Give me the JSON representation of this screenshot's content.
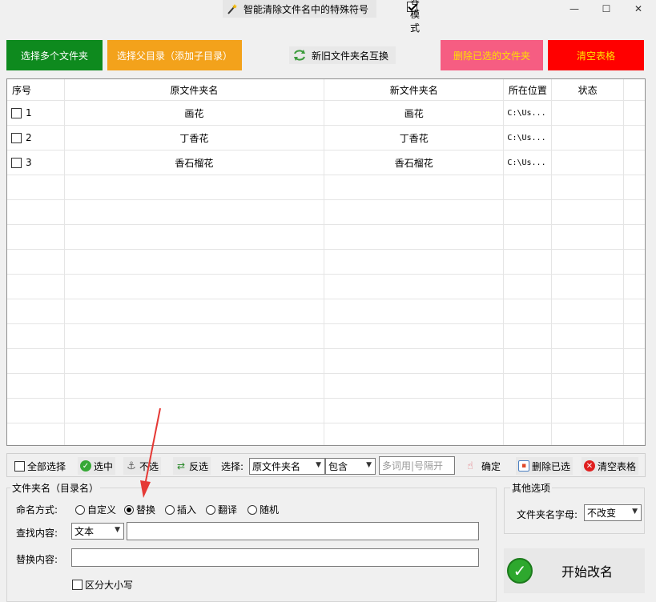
{
  "window": {
    "title": "智能清除文件名中的特殊符号",
    "compat_label": "兼容模式",
    "compat_checked": true,
    "minimize": "—",
    "maximize": "☐",
    "close": "✕"
  },
  "top_buttons": {
    "select_folders": "选择多个文件夹",
    "select_parent": "选择父目录（添加子目录）",
    "swap_names": "新旧文件夹名互换",
    "delete_selected": "删除已选的文件夹",
    "clear_table": "清空表格"
  },
  "table": {
    "columns": [
      "序号",
      "原文件夹名",
      "新文件夹名",
      "所在位置",
      "状态"
    ],
    "rows": [
      {
        "index": "1",
        "original": "画花",
        "new": "画花",
        "location": "C:\\Us...",
        "status": ""
      },
      {
        "index": "2",
        "original": "丁香花",
        "new": "丁香花",
        "location": "C:\\Us...",
        "status": ""
      },
      {
        "index": "3",
        "original": "香石榴花",
        "new": "香石榴花",
        "location": "C:\\Us...",
        "status": ""
      }
    ]
  },
  "toolbar": {
    "select_all": "全部选择",
    "check": "选中",
    "uncheck": "不选",
    "invert": "反选",
    "select_label": "选择:",
    "field_select": "原文件夹名",
    "match_select": "包含",
    "keyword_placeholder": "多词用|号隔开",
    "confirm": "确定",
    "delete_selected": "删除已选",
    "clear_table": "清空表格"
  },
  "folder_group": {
    "title": "文件夹名（目录名）",
    "naming_label": "命名方式:",
    "naming_options": [
      "自定义",
      "替换",
      "插入",
      "翻译",
      "随机"
    ],
    "naming_selected": "替换",
    "find_label": "查找内容:",
    "find_type": "文本",
    "find_value": "",
    "replace_label": "替换内容:",
    "replace_value": "",
    "case_sensitive_label": "区分大小写"
  },
  "other_group": {
    "title": "其他选项",
    "letter_label": "文件夹名字母:",
    "letter_value": "不改变"
  },
  "start_button": "开始改名",
  "colors": {
    "green": "#0e8a1e",
    "orange": "#f3a21b",
    "pink": "#f65d82",
    "red": "#ff0000",
    "yellow_text": "#ffe100",
    "annotation_arrow": "#e53935"
  }
}
